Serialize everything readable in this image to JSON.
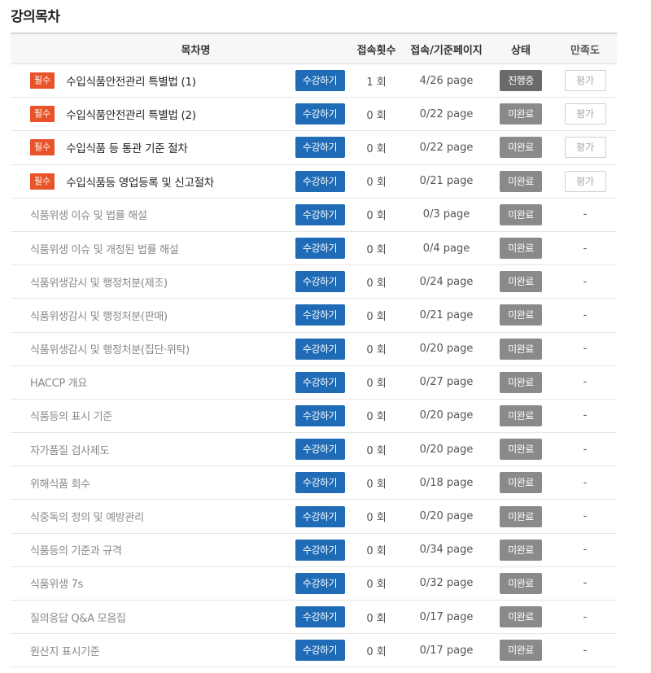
{
  "section_title": "강의목차",
  "headers": {
    "name": "목차명",
    "count": "접속횟수",
    "page": "접속/기준페이지",
    "status": "상태",
    "satisfaction": "만족도"
  },
  "labels": {
    "required": "필수",
    "study_button": "수강하기",
    "evaluate_button": "평가",
    "no_rating": "-"
  },
  "colors": {
    "required_badge": "#e8532a",
    "study_button": "#1f6bb6",
    "status_incomplete": "#8a8a8a",
    "status_in_progress": "#6a6a6a"
  },
  "rows": [
    {
      "title": "수입식품안전관리 특별법 (1)",
      "required": true,
      "count": "1 회",
      "page": "4/26 page",
      "status": "진행중"
    },
    {
      "title": "수입식품안전관리 특별법 (2)",
      "required": true,
      "count": "0 회",
      "page": "0/22 page",
      "status": "미완료"
    },
    {
      "title": "수입식품 등 통관 기준 절차",
      "required": true,
      "count": "0 회",
      "page": "0/22 page",
      "status": "미완료"
    },
    {
      "title": "수입식품등 영업등록 및 신고절차",
      "required": true,
      "count": "0 회",
      "page": "0/21 page",
      "status": "미완료"
    },
    {
      "title": "식품위생 이슈 및 법률 해설",
      "required": false,
      "count": "0 회",
      "page": "0/3 page",
      "status": "미완료"
    },
    {
      "title": "식품위생 이슈 및 개정된 법률 해설",
      "required": false,
      "count": "0 회",
      "page": "0/4 page",
      "status": "미완료"
    },
    {
      "title": "식품위생감시 및 행정처분(제조)",
      "required": false,
      "count": "0 회",
      "page": "0/24 page",
      "status": "미완료"
    },
    {
      "title": "식품위생감시 및 행정처분(판매)",
      "required": false,
      "count": "0 회",
      "page": "0/21 page",
      "status": "미완료"
    },
    {
      "title": "식품위생감시 및 행정처분(집단·위탁)",
      "required": false,
      "count": "0 회",
      "page": "0/20 page",
      "status": "미완료"
    },
    {
      "title": "HACCP 개요",
      "required": false,
      "count": "0 회",
      "page": "0/27 page",
      "status": "미완료"
    },
    {
      "title": "식품등의 표시 기준",
      "required": false,
      "count": "0 회",
      "page": "0/20 page",
      "status": "미완료"
    },
    {
      "title": "자가품질 검사제도",
      "required": false,
      "count": "0 회",
      "page": "0/20 page",
      "status": "미완료"
    },
    {
      "title": "위해식품 회수",
      "required": false,
      "count": "0 회",
      "page": "0/18 page",
      "status": "미완료"
    },
    {
      "title": "식중독의 정의 및 예방관리",
      "required": false,
      "count": "0 회",
      "page": "0/20 page",
      "status": "미완료"
    },
    {
      "title": "식품등의 기준과 규격",
      "required": false,
      "count": "0 회",
      "page": "0/34 page",
      "status": "미완료"
    },
    {
      "title": "식품위생 7s",
      "required": false,
      "count": "0 회",
      "page": "0/32 page",
      "status": "미완료"
    },
    {
      "title": "질의응답 Q&A 모음집",
      "required": false,
      "count": "0 회",
      "page": "0/17 page",
      "status": "미완료"
    },
    {
      "title": "원산지 표시기준",
      "required": false,
      "count": "0 회",
      "page": "0/17 page",
      "status": "미완료"
    }
  ]
}
